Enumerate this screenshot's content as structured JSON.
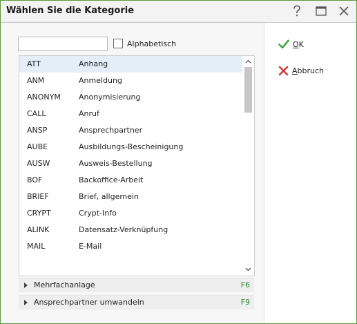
{
  "window": {
    "title": "Wählen Sie die Kategorie"
  },
  "titlebar": {
    "help_icon": "question-mark-icon",
    "maximize_icon": "maximize-icon",
    "close_icon": "close-icon"
  },
  "filter": {
    "search_value": "",
    "alphabetical_label": "Alphabetisch",
    "alphabetical_checked": false
  },
  "categories": [
    {
      "code": "ATT",
      "name": "Anhang",
      "selected": true
    },
    {
      "code": "ANM",
      "name": "Anmeldung"
    },
    {
      "code": "ANONYM",
      "name": "Anonymisierung"
    },
    {
      "code": "CALL",
      "name": "Anruf"
    },
    {
      "code": "ANSP",
      "name": "Ansprechpartner"
    },
    {
      "code": "AUBE",
      "name": "Ausbildungs-Bescheinigung"
    },
    {
      "code": "AUSW",
      "name": "Ausweis-Bestellung"
    },
    {
      "code": "BOF",
      "name": "Backoffice-Arbeit"
    },
    {
      "code": "BRIEF",
      "name": "Brief, allgemein"
    },
    {
      "code": "CRYPT",
      "name": "Crypt-Info"
    },
    {
      "code": "ALINK",
      "name": "Datensatz-Verknüpfung"
    },
    {
      "code": "MAIL",
      "name": "E-Mail"
    }
  ],
  "sections": [
    {
      "label": "Mehrfachanlage",
      "shortcut": "F6"
    },
    {
      "label": "Ansprechpartner umwandeln",
      "shortcut": "F9"
    }
  ],
  "actions": {
    "ok": {
      "mnemonic": "O",
      "rest": "K",
      "icon": "checkmark-icon"
    },
    "cancel": {
      "mnemonic": "A",
      "rest": "bbruch",
      "icon": "cross-icon"
    }
  },
  "colors": {
    "accent_green": "#5a9a3e",
    "ok_green": "#43a33a",
    "cancel_red": "#d23a3a",
    "selection": "#e4eef9",
    "shortcut_green": "#2f8a2f"
  }
}
